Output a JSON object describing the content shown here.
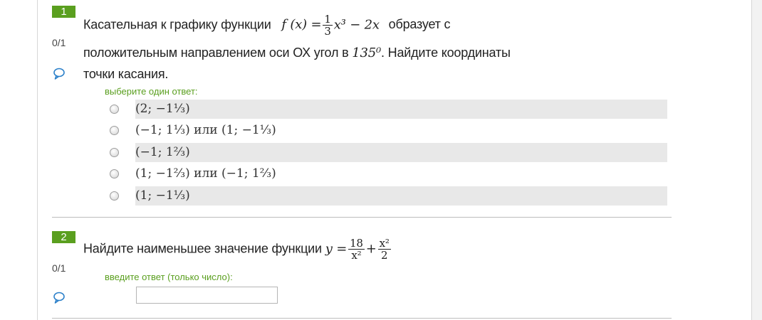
{
  "questions": [
    {
      "number": "1",
      "score": "0/1",
      "text_line1_prefix": "Касательная к графику функции",
      "formula_f": "f (x) =",
      "frac_num": "1",
      "frac_den": "3",
      "formula_tail": "x³ − 2x",
      "text_line1_suffix": "образует с",
      "text_line2": "положительным направлением оси ОХ угол в",
      "angle": "135⁰",
      "text_line2_suffix": ". Найдите координаты",
      "text_line3": "точки касания.",
      "prompt": "выберите один ответ:",
      "options": [
        "(2; −1⅓)",
        "(−1; 1⅓)  или  (1; −1⅓)",
        "(−1; 1⅔)",
        "(1; −1⅔)  или  (−1; 1⅔)",
        "(1; −1⅓)"
      ]
    },
    {
      "number": "2",
      "score": "0/1",
      "text_prefix": "Найдите наименьшее значение функции",
      "formula_y": "y =",
      "frac1_num": "18",
      "frac1_den": "x²",
      "plus": "+",
      "frac2_num": "x²",
      "frac2_den": "2",
      "prompt": "введите ответ (только число):",
      "input_value": ""
    }
  ],
  "colors": {
    "accent": "#5a9f1f",
    "shaded_row": "#e8e8e8",
    "comment_icon": "#2a7fc9"
  },
  "icons": {
    "comment": "comment-bubble-icon"
  }
}
